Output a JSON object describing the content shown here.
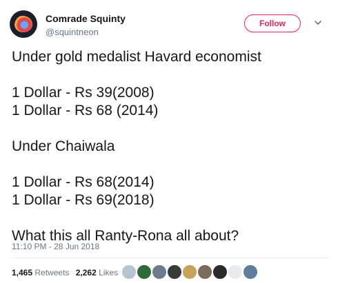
{
  "user": {
    "name": "Comrade Squinty",
    "handle": "@squintneon"
  },
  "follow_label": "Follow",
  "tweet": {
    "text": "Under gold medalist Havard economist\n\n1 Dollar - Rs 39(2008)\n1 Dollar - Rs 68 (2014)\n\nUnder Chaiwala\n\n1 Dollar - Rs 68(2014)\n1 Dollar - Rs 69(2018)\n\nWhat this all Ranty-Rona all about?"
  },
  "timestamp": "11:10 PM - 28 Jun 2018",
  "stats": {
    "retweets_count": "1,465",
    "retweets_label": "Retweets",
    "likes_count": "2,262",
    "likes_label": "Likes"
  },
  "colors": {
    "accent": "#e0245e",
    "secondary_text": "#657786",
    "text": "#14171a"
  },
  "icons": {
    "menu": "chevron-down-icon"
  }
}
